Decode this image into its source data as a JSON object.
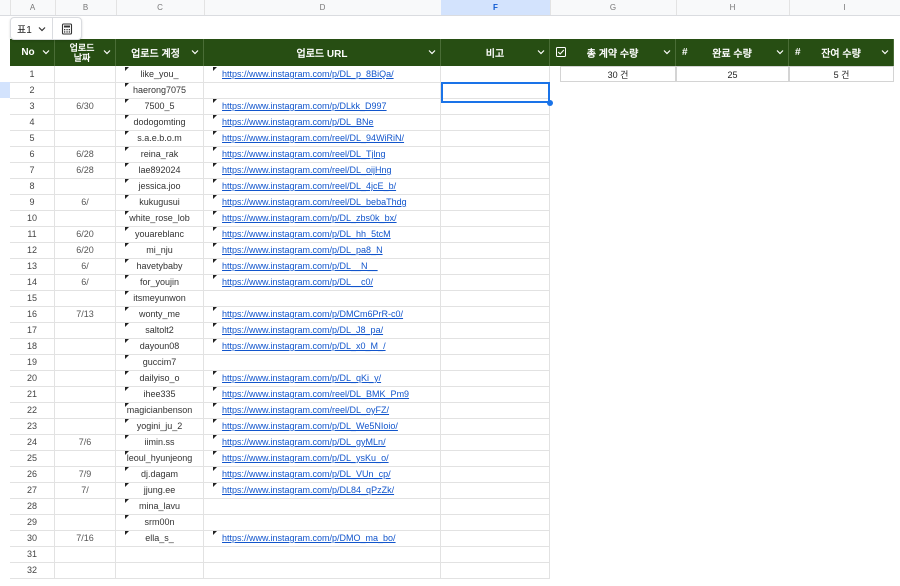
{
  "colheads": [
    "A",
    "B",
    "C",
    "D",
    "E",
    "F",
    "G",
    "H",
    "I"
  ],
  "selected_col": "F",
  "table_name": "표1",
  "headers": {
    "no": "No",
    "date": "업로드\n날짜",
    "account": "업로드 계정",
    "url": "업로드 URL",
    "note": "비고",
    "total": "총 계약 수량",
    "done": "완료 수량",
    "remain": "잔여 수량"
  },
  "summary": {
    "total": "30 건",
    "done": "25",
    "remain": "5 건"
  },
  "rows": [
    {
      "no": "1",
      "date": "",
      "account": "like_you_",
      "url": "https://www.instagram.com/p/DL_p_8BiQa/"
    },
    {
      "no": "2",
      "date": "",
      "account": "haerong7075",
      "url": ""
    },
    {
      "no": "3",
      "date": "6/30",
      "account": "7500_5",
      "url": "https://www.instagram.com/p/DLkk_D997"
    },
    {
      "no": "4",
      "date": "",
      "account": "dodogomting",
      "url": "https://www.instagram.com/p/DL_BNe"
    },
    {
      "no": "5",
      "date": "",
      "account": "s.a.e.b.o.m",
      "url": "https://www.instagram.com/reel/DL_94WiRiN/"
    },
    {
      "no": "6",
      "date": "6/28",
      "account": "reina_rak",
      "url": "https://www.instagram.com/reel/DL_Tjlng"
    },
    {
      "no": "7",
      "date": "6/28",
      "account": "lae892024",
      "url": "https://www.instagram.com/reel/DL_oijHng"
    },
    {
      "no": "8",
      "date": "",
      "account": "jessica.joo",
      "url": "https://www.instagram.com/reel/DL_4jcE_b/"
    },
    {
      "no": "9",
      "date": "6/",
      "account": "kukugusui",
      "url": "https://www.instagram.com/reel/DL_bebaThdg"
    },
    {
      "no": "10",
      "date": "",
      "account": "white_rose_lob",
      "url": "https://www.instagram.com/p/DL_zbs0k_bx/"
    },
    {
      "no": "11",
      "date": "6/20",
      "account": "youareblanc",
      "url": "https://www.instagram.com/p/DL_hh_5tcM"
    },
    {
      "no": "12",
      "date": "6/20",
      "account": "mi_nju",
      "url": "https://www.instagram.com/p/DL_pa8_N"
    },
    {
      "no": "13",
      "date": "6/",
      "account": "havetybaby",
      "url": "https://www.instagram.com/p/DL__N__"
    },
    {
      "no": "14",
      "date": "6/",
      "account": "for_youjin",
      "url": "https://www.instagram.com/p/DL__c0/"
    },
    {
      "no": "15",
      "date": "",
      "account": "itsmeyunwon",
      "url": ""
    },
    {
      "no": "16",
      "date": "7/13",
      "account": "wonty_me",
      "url": "https://www.instagram.com/p/DMCm6PrR-c0/"
    },
    {
      "no": "17",
      "date": "",
      "account": "saltolt2",
      "url": "https://www.instagram.com/p/DL_J8_pa/"
    },
    {
      "no": "18",
      "date": "",
      "account": "dayoun08",
      "url": "https://www.instagram.com/p/DL_x0_M_/"
    },
    {
      "no": "19",
      "date": "",
      "account": "guccim7",
      "url": ""
    },
    {
      "no": "20",
      "date": "",
      "account": "dailyiso_o",
      "url": "https://www.instagram.com/p/DL_qKi_y/"
    },
    {
      "no": "21",
      "date": "",
      "account": "ihee335",
      "url": "https://www.instagram.com/reel/DL_BMK_Pm9"
    },
    {
      "no": "22",
      "date": "",
      "account": "magicianbenson",
      "url": "https://www.instagram.com/reel/DL_oyFZ/"
    },
    {
      "no": "23",
      "date": "",
      "account": "yogini_ju_2",
      "url": "https://www.instagram.com/p/DL_We5NIoio/"
    },
    {
      "no": "24",
      "date": "7/6",
      "account": "iimin.ss",
      "url": "https://www.instagram.com/p/DL_gyMLn/"
    },
    {
      "no": "25",
      "date": "",
      "account": "leoul_hyunjeong",
      "url": "https://www.instagram.com/p/DL_ysKu_o/"
    },
    {
      "no": "26",
      "date": "7/9",
      "account": "dj.dagam",
      "url": "https://www.instagram.com/p/DL_VUn_cp/"
    },
    {
      "no": "27",
      "date": "7/",
      "account": "jjung.ee",
      "url": "https://www.instagram.com/p/DL84_qPzZk/"
    },
    {
      "no": "28",
      "date": "",
      "account": "mina_lavu",
      "url": ""
    },
    {
      "no": "29",
      "date": "",
      "account": "srm00n",
      "url": ""
    },
    {
      "no": "30",
      "date": "7/16",
      "account": "ella_s_",
      "url": "https://www.instagram.com/p/DMO_ma_bo/"
    },
    {
      "no": "31",
      "date": "",
      "account": "",
      "url": ""
    },
    {
      "no": "32",
      "date": "",
      "account": "",
      "url": ""
    }
  ],
  "colors": {
    "header_bg": "#274e13",
    "link": "#1155cc",
    "selection": "#1a73e8"
  }
}
